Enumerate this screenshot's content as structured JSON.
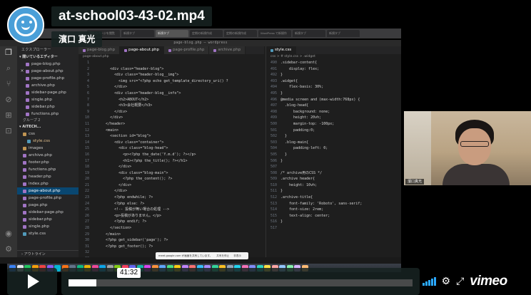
{
  "video": {
    "title": "at-school03-43-02.mp4",
    "owner": "濱口 真光",
    "current_time": "41:32",
    "progress": 0.08
  },
  "browser": {
    "tabs": [
      {
        "label": "現在のページを閲覧",
        "active": false
      },
      {
        "label": "新規タブ",
        "active": false
      },
      {
        "label": "新規タブ",
        "active": true
      },
      {
        "label": "定期の新規作成",
        "active": false
      },
      {
        "label": "定期の新規作成",
        "active": false
      },
      {
        "label": "WordPress で新規作",
        "active": false
      },
      {
        "label": "新規タブ",
        "active": false
      },
      {
        "label": "新規タブ",
        "active": false
      }
    ]
  },
  "vscode": {
    "window_title": "page-blog.php — wordpress",
    "explorer_title": "エクスプローラー",
    "open_editors_header": "開いているエディター",
    "open_editors": [
      {
        "name": "page-blog.php",
        "color": "#a074c4",
        "selected": false,
        "modified": false,
        "close": false
      },
      {
        "name": "page-about.php",
        "color": "#a074c4",
        "selected": false,
        "modified": false,
        "close": true
      },
      {
        "name": "page-profile.php",
        "color": "#a074c4",
        "selected": false,
        "modified": false,
        "close": false
      },
      {
        "name": "archive.php",
        "color": "#a074c4",
        "selected": false,
        "modified": false,
        "close": false
      },
      {
        "name": "sidebar-page.php",
        "color": "#a074c4",
        "selected": false,
        "modified": false,
        "close": false
      },
      {
        "name": "single.php",
        "color": "#a074c4",
        "selected": false,
        "modified": false,
        "close": false
      },
      {
        "name": "sidebar.php",
        "color": "#a074c4",
        "selected": false,
        "modified": false,
        "close": false
      },
      {
        "name": "functions.php",
        "color": "#a074c4",
        "selected": false,
        "modified": false,
        "close": false
      }
    ],
    "group_label": "グループ 2",
    "workspace_header": "AITECH...",
    "workspace_files": [
      {
        "name": "css",
        "color": "#c09553",
        "indent": 1,
        "selected": false,
        "modified": false
      },
      {
        "name": "style.css",
        "color": "#519aba",
        "indent": 2,
        "selected": false,
        "modified": true
      },
      {
        "name": "images",
        "color": "#c09553",
        "indent": 1,
        "selected": false,
        "modified": false
      },
      {
        "name": "archive.php",
        "color": "#a074c4",
        "indent": 1,
        "selected": false,
        "modified": false
      },
      {
        "name": "footer.php",
        "color": "#a074c4",
        "indent": 1,
        "selected": false,
        "modified": false
      },
      {
        "name": "functions.php",
        "color": "#a074c4",
        "indent": 1,
        "selected": false,
        "modified": false
      },
      {
        "name": "header.php",
        "color": "#a074c4",
        "indent": 1,
        "selected": false,
        "modified": false
      },
      {
        "name": "index.php",
        "color": "#a074c4",
        "indent": 1,
        "selected": false,
        "modified": false
      },
      {
        "name": "page-about.php",
        "color": "#a074c4",
        "indent": 1,
        "selected": true,
        "modified": false
      },
      {
        "name": "page-profile.php",
        "color": "#a074c4",
        "indent": 1,
        "selected": false,
        "modified": false
      },
      {
        "name": "page.php",
        "color": "#a074c4",
        "indent": 1,
        "selected": false,
        "modified": false
      },
      {
        "name": "sidebar-page.php",
        "color": "#a074c4",
        "indent": 1,
        "selected": false,
        "modified": false
      },
      {
        "name": "sidebar.php",
        "color": "#a074c4",
        "indent": 1,
        "selected": false,
        "modified": false
      },
      {
        "name": "single.php",
        "color": "#a074c4",
        "indent": 1,
        "selected": false,
        "modified": false
      },
      {
        "name": "style.css",
        "color": "#519aba",
        "indent": 1,
        "selected": false,
        "modified": false
      }
    ],
    "outline_label": "アウトライン",
    "editor1_tabs": [
      {
        "label": "page-blog.php",
        "color": "#a074c4",
        "active": false
      },
      {
        "label": "page-about.php",
        "color": "#a074c4",
        "active": true
      },
      {
        "label": "page-profile.php",
        "color": "#a074c4",
        "active": false
      },
      {
        "label": "archive.php",
        "color": "#a074c4",
        "active": false
      }
    ],
    "editor1_breadcrumb": "page-about.php",
    "editor1_lines": [
      {
        "n": "1",
        "t": ""
      },
      {
        "n": "2",
        "t": "        <div class=\"header-blog\">"
      },
      {
        "n": "3",
        "t": "          <div class=\"header-blog__img\">"
      },
      {
        "n": "4",
        "t": "            <img src=\"<?php echo get_template_directory_uri() ?"
      },
      {
        "n": "5",
        "t": "          </div>"
      },
      {
        "n": "6",
        "t": "          <div class=\"header-blog__info\">"
      },
      {
        "n": "7",
        "t": "            <h2>ABOUT</h2>"
      },
      {
        "n": "8",
        "t": "            <h3>会社概要</h3>"
      },
      {
        "n": "9",
        "t": "          </div>"
      },
      {
        "n": "10",
        "t": "        </div>"
      },
      {
        "n": "11",
        "t": "      </header>"
      },
      {
        "n": "12",
        "t": "      <main>"
      },
      {
        "n": "13",
        "t": "        <section id=\"blog\">"
      },
      {
        "n": "14",
        "t": "          <div class=\"container\">"
      },
      {
        "n": "15",
        "t": "            <div class=\"blog-head\">"
      },
      {
        "n": "16",
        "t": "              <p><?php the_date('Y.m.d'); ?></p>"
      },
      {
        "n": "17",
        "t": "              <h1><?php the_title(); ?></h1>"
      },
      {
        "n": "18",
        "t": "            </div>"
      },
      {
        "n": "19",
        "t": "            <div class=\"blog-main\">"
      },
      {
        "n": "20",
        "t": "              <?php the_content(); ?>"
      },
      {
        "n": "21",
        "t": "            </div>"
      },
      {
        "n": "22",
        "t": "          </div>"
      },
      {
        "n": "23",
        "t": "          <?php endwhile; ?>"
      },
      {
        "n": "24",
        "t": "          <?php else: ?>"
      },
      {
        "n": "25",
        "t": "          <!-- 投稿が無い場合の処理 -->"
      },
      {
        "n": "26",
        "t": "          <p>投稿がありません。</p>"
      },
      {
        "n": "27",
        "t": "          <?php endif; ?>"
      },
      {
        "n": "28",
        "t": "        </section>"
      },
      {
        "n": "29",
        "t": "      </main>"
      },
      {
        "n": "30",
        "t": "      <?php get_sidebar('page'); ?>"
      },
      {
        "n": "31",
        "t": "      <?php get_footer(); ?>"
      },
      {
        "n": "32",
        "t": ""
      },
      {
        "n": "33",
        "t": ""
      },
      {
        "n": "34",
        "t": ""
      }
    ],
    "editor2_tabs": [
      {
        "label": "style.css",
        "color": "#519aba",
        "active": true
      }
    ],
    "editor2_breadcrumb": "css > # style.css > .widget",
    "editor2_lines": [
      {
        "n": "490",
        "t": ".sidebar-content{"
      },
      {
        "n": "491",
        "t": "    display: flex;"
      },
      {
        "n": "492",
        "t": "}"
      },
      {
        "n": "493",
        "t": ".widget{"
      },
      {
        "n": "494",
        "t": "    flex-basis: 30%;"
      },
      {
        "n": "495",
        "t": "}"
      },
      {
        "n": "496",
        "t": "@media screen and (max-width:768px) {"
      },
      {
        "n": "497",
        "t": "  .blog-head{"
      },
      {
        "n": "498",
        "t": "      background: none;"
      },
      {
        "n": "499",
        "t": "      height: 20vh;"
      },
      {
        "n": "500",
        "t": "      margin-top: -100px;"
      },
      {
        "n": "501",
        "t": "      padding:0;"
      },
      {
        "n": "502",
        "t": "  }"
      },
      {
        "n": "503",
        "t": "  .blog-main{"
      },
      {
        "n": "504",
        "t": "      padding-left: 0;"
      },
      {
        "n": "505",
        "t": "  }"
      },
      {
        "n": "506",
        "t": "}"
      },
      {
        "n": "507",
        "t": ""
      },
      {
        "n": "508",
        "t": "/* archive用のCSS */"
      },
      {
        "n": "509",
        "t": ".archive header{"
      },
      {
        "n": "510",
        "t": "    height: 10vh;"
      },
      {
        "n": "511",
        "t": "}"
      },
      {
        "n": "512",
        "t": ".archive-title{"
      },
      {
        "n": "513",
        "t": "    font-family: 'Roboto', sans-serif;"
      },
      {
        "n": "514",
        "t": "    font-size: 2rem;"
      },
      {
        "n": "515",
        "t": "    text-align: center;"
      },
      {
        "n": "516",
        "t": "}"
      },
      {
        "n": "517",
        "t": ""
      }
    ],
    "notification": {
      "text": "meet.google.com が画面を共有しています。",
      "stop_label": "共有を停止",
      "hide_label": "非表示"
    }
  },
  "webcam": {
    "name_tag": "濱口真光"
  },
  "player": {
    "logo": "vimeo",
    "icons": {
      "play": "play-icon",
      "volume": "volume-icon",
      "settings": "gear-icon",
      "fullscreen": "fullscreen-icon"
    },
    "accent_color": "#2ba8ff"
  }
}
